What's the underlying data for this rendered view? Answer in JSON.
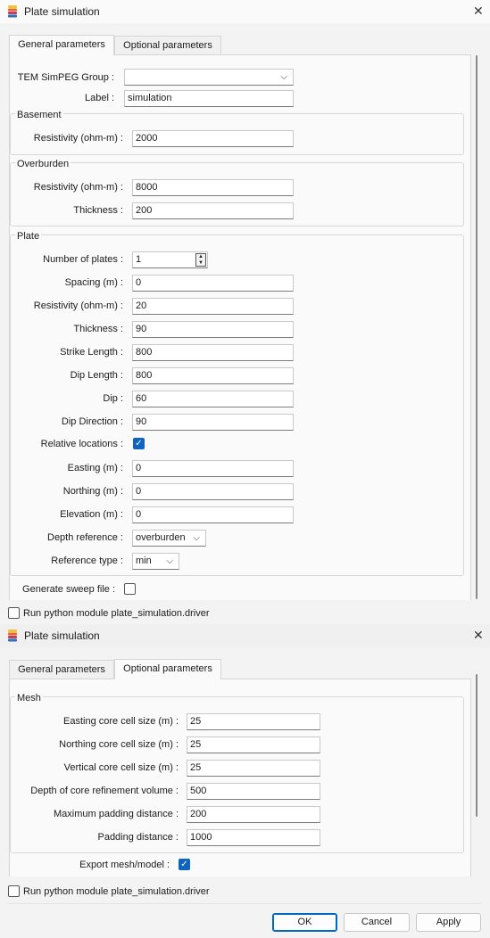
{
  "window1": {
    "title": "Plate simulation",
    "tabs": [
      "General parameters",
      "Optional parameters"
    ],
    "tem_group_label": "TEM SimPEG Group :",
    "tem_group_value": "",
    "label_label": "Label :",
    "label_value": "simulation",
    "basement": {
      "title": "Basement",
      "resistivity_label": "Resistivity (ohm-m) :",
      "resistivity_value": "2000"
    },
    "overburden": {
      "title": "Overburden",
      "resistivity_label": "Resistivity (ohm-m) :",
      "resistivity_value": "8000",
      "thickness_label": "Thickness :",
      "thickness_value": "200"
    },
    "plate": {
      "title": "Plate",
      "number_label": "Number of plates :",
      "number_value": "1",
      "spacing_label": "Spacing (m) :",
      "spacing_value": "0",
      "resistivity_label": "Resistivity (ohm-m) :",
      "resistivity_value": "20",
      "thickness_label": "Thickness :",
      "thickness_value": "90",
      "strike_label": "Strike Length :",
      "strike_value": "800",
      "diplength_label": "Dip Length :",
      "diplength_value": "800",
      "dip_label": "Dip :",
      "dip_value": "60",
      "dipdir_label": "Dip Direction :",
      "dipdir_value": "90",
      "relative_label": "Relative locations :",
      "relative_checked": true,
      "easting_label": "Easting (m) :",
      "easting_value": "0",
      "northing_label": "Northing (m) :",
      "northing_value": "0",
      "elevation_label": "Elevation (m) :",
      "elevation_value": "0",
      "depthref_label": "Depth reference :",
      "depthref_value": "overburden",
      "reftype_label": "Reference type :",
      "reftype_value": "min"
    },
    "sweep_label": "Generate sweep file :",
    "sweep_checked": false,
    "run_label": "Run python module plate_simulation.driver",
    "run_checked": false
  },
  "window2": {
    "title": "Plate simulation",
    "tabs": [
      "General parameters",
      "Optional parameters"
    ],
    "mesh": {
      "title": "Mesh",
      "easting_label": "Easting core cell size (m) :",
      "easting_value": "25",
      "northing_label": "Northing core cell size (m) :",
      "northing_value": "25",
      "vertical_label": "Vertical core cell size (m) :",
      "vertical_value": "25",
      "depth_label": "Depth of core refinement volume :",
      "depth_value": "500",
      "maxpad_label": "Maximum padding distance :",
      "maxpad_value": "200",
      "padding_label": "Padding distance :",
      "padding_value": "1000"
    },
    "export_label": "Export mesh/model :",
    "export_checked": true,
    "run_label": "Run python module plate_simulation.driver",
    "run_checked": false,
    "buttons": {
      "ok": "OK",
      "cancel": "Cancel",
      "apply": "Apply"
    }
  },
  "colors": {
    "accent": "#0f64c0",
    "background": "#f3f3f3",
    "pane": "#fafafa"
  },
  "icons": {
    "app": "layered-stack-icon",
    "close": "close-icon",
    "check": "checkmark-icon",
    "dropdown": "chevron-down-icon"
  }
}
